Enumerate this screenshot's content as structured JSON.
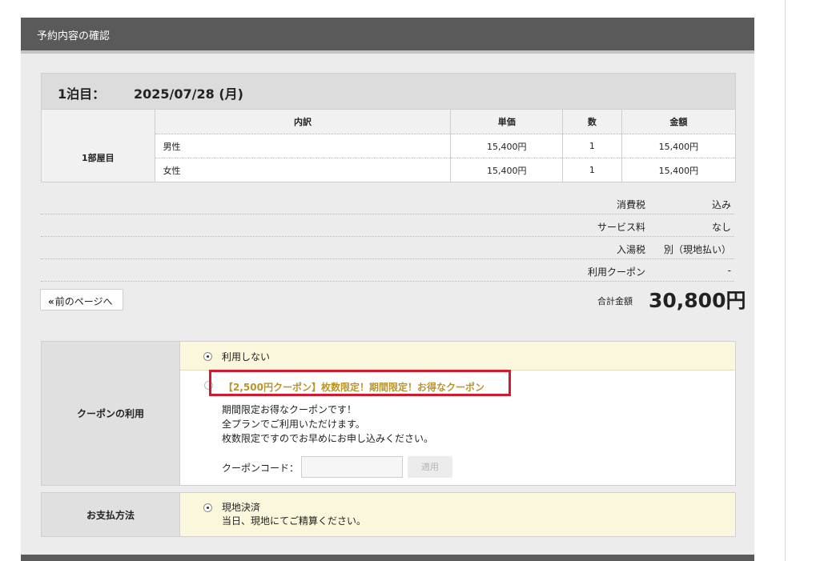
{
  "panel": {
    "title": "予約内容の確認"
  },
  "night": {
    "label": "1泊目：",
    "date": "2025/07/28 (月)",
    "columns": [
      "内訳",
      "単価",
      "数",
      "金額"
    ],
    "room_label": "1部屋目",
    "rows": [
      {
        "item": "男性",
        "unit": "15,400円",
        "qty": "1",
        "amount": "15,400円"
      },
      {
        "item": "女性",
        "unit": "15,400円",
        "qty": "1",
        "amount": "15,400円"
      }
    ]
  },
  "summary": [
    {
      "label": "消費税",
      "value": "込み"
    },
    {
      "label": "サービス料",
      "value": "なし"
    },
    {
      "label": "入湯税",
      "value": "別（現地払い）"
    },
    {
      "label": "利用クーポン",
      "value": "-"
    }
  ],
  "prev_button": {
    "chevron": "«",
    "label": "前のページへ"
  },
  "total": {
    "label": "合計金額",
    "value": "30,800円"
  },
  "coupon": {
    "section_label": "クーポンの利用",
    "none_label": "利用しない",
    "option_title": "【2,500円クーポン】枚数限定！期間限定！お得なクーポン",
    "desc_lines": [
      "期間限定お得なクーポンです！",
      "全プランでご利用いただけます。",
      "枚数限定ですのでお早めにお申し込みください。"
    ],
    "code_label": "クーポンコード：",
    "code_value": "",
    "apply_label": "適用"
  },
  "payment": {
    "section_label": "お支払方法",
    "option_label": "現地決済",
    "option_note": "当日、現地にてご精算ください。"
  },
  "colors": {
    "highlight": "#d31a2f",
    "coupon_title": "#b6962c",
    "header_bg": "#5a5a5a"
  }
}
